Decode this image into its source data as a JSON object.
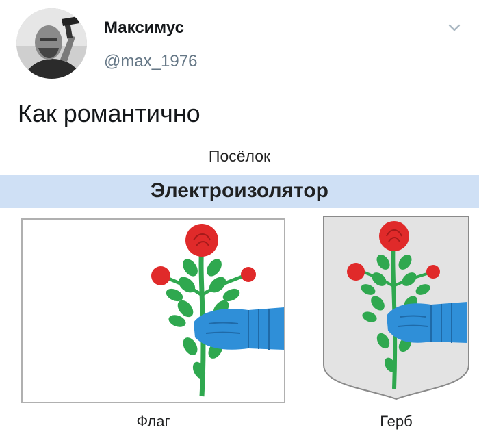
{
  "author": {
    "display_name": "Максимус",
    "handle": "@max_1976"
  },
  "tweet": {
    "text": "Как романтично"
  },
  "infobox": {
    "settlement_type": "Посёлок",
    "settlement_name": "Электроизолятор",
    "flag_caption": "Флаг",
    "coat_caption": "Герб"
  },
  "colors": {
    "name_band": "#cfe0f5",
    "rose_red": "#e02a2a",
    "leaf_green": "#2fa84f",
    "gauntlet_blue": "#2f8fd8",
    "shield_grey": "#e3e3e3"
  },
  "icons": {
    "menu": "chevron-down-icon"
  }
}
